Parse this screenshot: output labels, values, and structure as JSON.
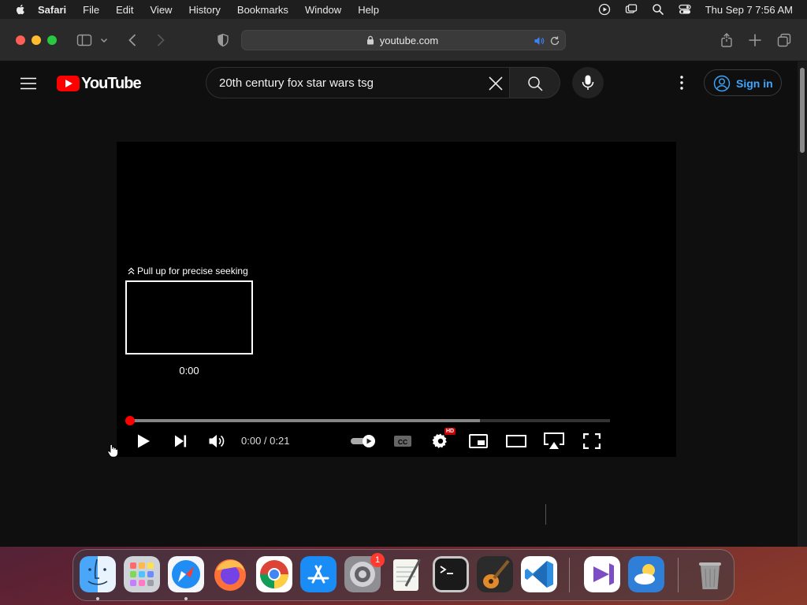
{
  "menubar": {
    "items": [
      "Safari",
      "File",
      "Edit",
      "View",
      "History",
      "Bookmarks",
      "Window",
      "Help"
    ],
    "clock": "Thu Sep 7  7:56 AM"
  },
  "browser": {
    "url": "youtube.com"
  },
  "youtube": {
    "logo_text": "YouTube",
    "search_query": "20th century fox star wars tsg",
    "signin_label": "Sign in"
  },
  "player": {
    "seek_hint": "Pull up for precise seeking",
    "preview_time": "0:00",
    "time_display": "0:00 / 0:21",
    "hd_badge": "HD",
    "buffered_fraction": 0.73,
    "played_fraction": 0.0
  },
  "dock": {
    "apps": [
      "Finder",
      "Launchpad",
      "Safari",
      "Firefox",
      "Google Chrome",
      "App Store",
      "System Settings",
      "TextEdit",
      "Terminal",
      "GarageBand",
      "Visual Studio Code",
      "Visual Studio",
      "Weather",
      "Trash"
    ],
    "settings_badge": "1"
  },
  "colors": {
    "youtube_red": "#ff0000",
    "link_blue": "#3ea6ff"
  }
}
